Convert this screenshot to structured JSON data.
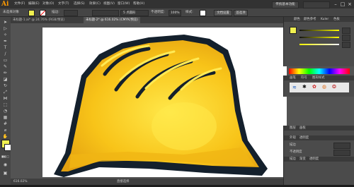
{
  "app": {
    "logo": "Ai"
  },
  "menu": [
    "文件(F)",
    "编辑(E)",
    "对象(O)",
    "文字(T)",
    "选择(S)",
    "效果(C)",
    "视图(V)",
    "窗口(W)",
    "帮助(H)"
  ],
  "workspace": {
    "label": "传统基本功能"
  },
  "control_bar": {
    "selection_label": "未选择对象",
    "stroke_label": "描边:",
    "stroke_value": "",
    "brush_label": "5 点圆形",
    "opacity_label": "不透明度:",
    "opacity_value": "100%",
    "style_label": "样式:",
    "doc_setup": "文档设置",
    "prefs": "首选项"
  },
  "tabs": [
    {
      "label": "未标题-1.ai* @ 24.76% (RGB/预览)",
      "active": false
    },
    {
      "label": "未标题-2* @ 616.02% (CMYK/预览)",
      "active": true
    }
  ],
  "colors": {
    "helmet_main": "#f8c419",
    "helmet_light": "#ffe23a",
    "helmet_outline": "#14202c",
    "fill_swatch": "#f0f050"
  },
  "panels": {
    "color_tabs": [
      "颜色",
      "颜色参考",
      "Kuler",
      "色板"
    ],
    "swatch_tabs": [
      "画笔",
      "符号",
      "图形样式"
    ],
    "layer_tabs": [
      "图层",
      "画板"
    ],
    "layer_tabs2": [
      "外观",
      "透明度"
    ],
    "stroke_tabs": [
      "描边",
      "渐变",
      "透明度"
    ],
    "appearance_label": "描边",
    "transparency_label": "不透明度"
  },
  "status": {
    "zoom": "616.02%",
    "tool": "直接选择"
  }
}
